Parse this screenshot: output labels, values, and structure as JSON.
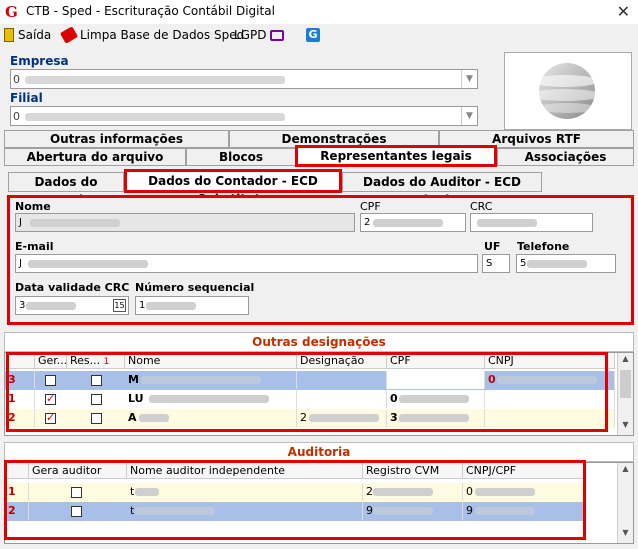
{
  "window": {
    "title": "CTB - Sped - Escrituração Contábil Digital",
    "icon_letter": "G"
  },
  "toolbar": {
    "exit_label": "Saída",
    "clear_label": "Limpa Base de Dados Sped",
    "lgpd_label": "LGPD"
  },
  "empresa": {
    "label": "Empresa",
    "value": "0"
  },
  "filial": {
    "label": "Filial",
    "value": "0"
  },
  "tabs_row1": [
    "Outras informações",
    "Demonstrações",
    "Arquivos RTF"
  ],
  "tabs_row2": [
    "Abertura do arquivo",
    "Blocos",
    "Representantes legais",
    "Associações"
  ],
  "subtabs": [
    "Dados do Contador",
    "Dados do Contador - ECD Substituta",
    "Dados do Auditor - ECD Substituta"
  ],
  "form": {
    "nome_label": "Nome",
    "nome_value": "J",
    "cpf_label": "CPF",
    "cpf_value": "2",
    "crc_label": "CRC",
    "crc_value": "",
    "email_label": "E-mail",
    "email_value": "J",
    "uf_label": "UF",
    "uf_value": "S",
    "telefone_label": "Telefone",
    "telefone_value": "5",
    "validade_label": "Data validade CRC",
    "validade_value": "3",
    "numseq_label": "Número sequencial",
    "numseq_value": "1",
    "cal_icon": "15"
  },
  "outras": {
    "title": "Outras designações",
    "headers": [
      "Ger...",
      "Res...",
      "Nome",
      "Designação",
      "CPF",
      "CNPJ"
    ],
    "sort_indicator": "1",
    "rows": [
      {
        "num": "3",
        "ger": false,
        "res": false,
        "nome": "M",
        "designacao": "",
        "cpf": "",
        "cnpj": "0"
      },
      {
        "num": "1",
        "ger": true,
        "res": false,
        "nome": "LU",
        "designacao": "",
        "cpf": "0",
        "cnpj": ""
      },
      {
        "num": "2",
        "ger": true,
        "res": false,
        "nome": "A",
        "designacao": "2",
        "cpf": "3",
        "cnpj": ""
      }
    ]
  },
  "auditoria": {
    "title": "Auditoria",
    "headers": [
      "Gera auditor",
      "Nome auditor independente",
      "Registro CVM",
      "CNPJ/CPF"
    ],
    "rows": [
      {
        "num": "1",
        "gera": false,
        "nome": "t",
        "registro": "2",
        "cnpj": "0"
      },
      {
        "num": "2",
        "gera": false,
        "nome": "t",
        "registro": "9",
        "cnpj": "9"
      }
    ]
  },
  "colors": {
    "accent_red": "#e00000",
    "selected_row": "#a8c0e8",
    "highlight_row": "#fffbe0"
  }
}
